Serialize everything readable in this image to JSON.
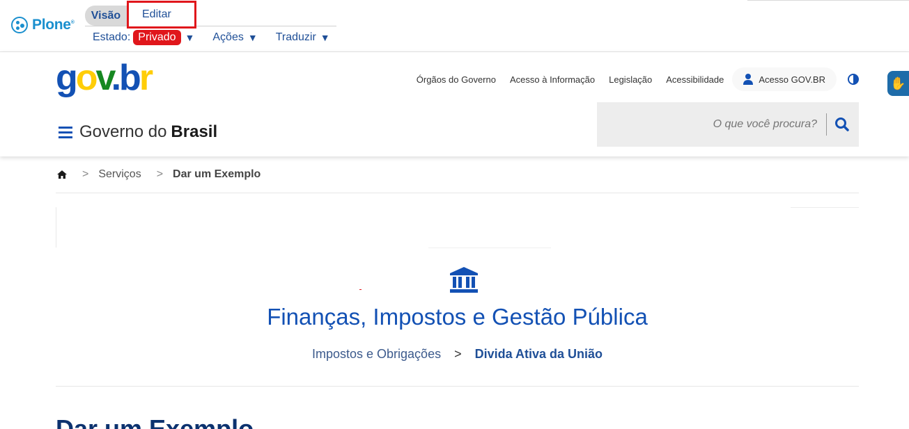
{
  "plone": {
    "logo_text": "Plone",
    "tabs": {
      "view": "Visão",
      "edit": "Editar"
    },
    "state_label": "Estado:",
    "state_value": "Privado",
    "actions_label": "Ações",
    "translate_label": "Traduzir",
    "arrow": "▼"
  },
  "header": {
    "links": [
      "Órgãos do Governo",
      "Acesso à Informação",
      "Legislação",
      "Acessibilidade"
    ],
    "login_label": "Acesso GOV.BR",
    "title_prefix": "Governo do",
    "title_bold": "Brasil",
    "search_placeholder": "O que você procura?"
  },
  "breadcrumb": {
    "sep": ">",
    "items": [
      "Serviços",
      "Dar um Exemplo"
    ]
  },
  "content": {
    "section_title": "Finanças, Impostos e Gestão Pública",
    "sub_crumb_first": "Impostos e Obrigações",
    "sub_crumb_sep": ">",
    "sub_crumb_second": "Divida Ativa da União",
    "page_title": "Dar um Exemplo"
  },
  "colors": {
    "primary": "#1351b4",
    "edit_highlight": "#e0161b",
    "state_badge": "#e0161b"
  }
}
